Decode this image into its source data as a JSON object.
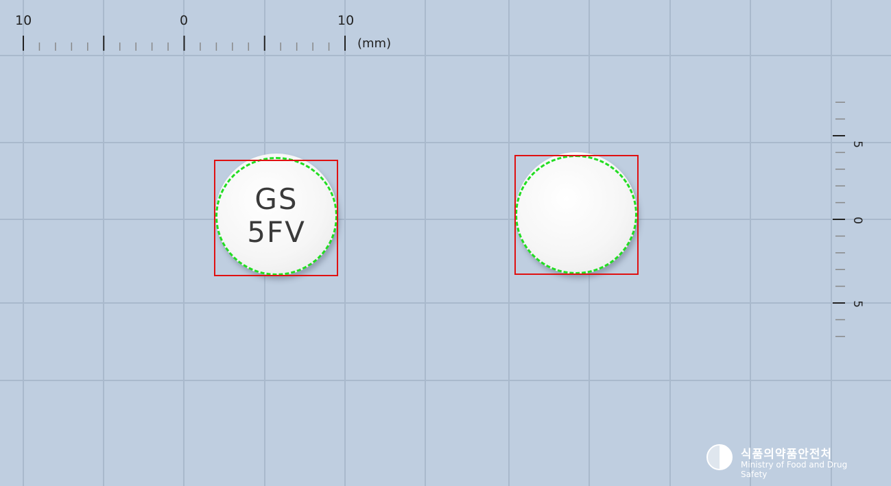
{
  "ruler_top": {
    "labels": [
      "10",
      "0",
      "10"
    ],
    "unit": "(mm)"
  },
  "ruler_side": {
    "labels": [
      "5",
      "0",
      "5"
    ]
  },
  "pills": [
    {
      "imprint_line1": "GS",
      "imprint_line2": "5FV"
    },
    {
      "imprint_line1": "",
      "imprint_line2": ""
    }
  ],
  "logo": {
    "korean_name": "식품의약품안전처",
    "english_name": "Ministry of Food and Drug Safety"
  },
  "colors": {
    "background": "#bfcee0",
    "grid": "#a9b9cc",
    "detection_box": "#e01010",
    "contour": "#22dd22"
  }
}
